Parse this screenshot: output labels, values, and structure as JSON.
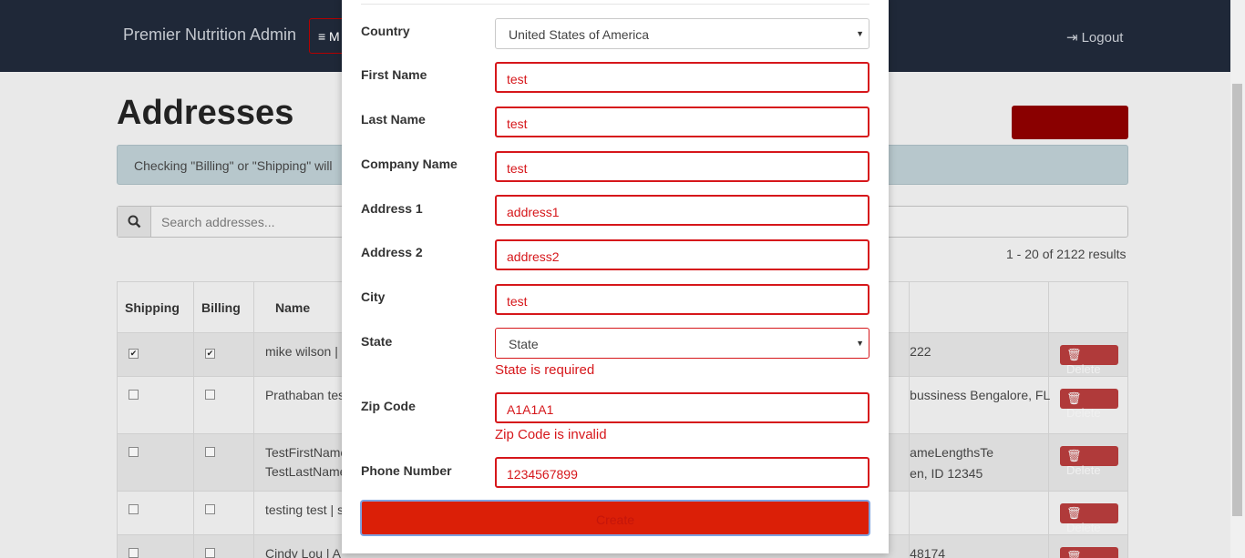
{
  "navbar": {
    "brand": "Premier Nutrition Admin",
    "menu_label": "≡ M",
    "logout_label": "Logout"
  },
  "page": {
    "title": "Addresses",
    "alert_text": "Checking \"Billing\" or \"Shipping\" will",
    "search_placeholder": "Search addresses...",
    "results_text": "1 - 20 of 2122 results"
  },
  "table": {
    "headers": {
      "shipping": "Shipping",
      "billing": "Billing",
      "name": "Name"
    },
    "delete_label": "Delete",
    "rows": [
      {
        "shipping": true,
        "billing": true,
        "name": "mike wilson |",
        "tail": "222"
      },
      {
        "shipping": false,
        "billing": false,
        "name": "Prathaban tes",
        "tail": "bussiness Bengalore, FL"
      },
      {
        "shipping": false,
        "billing": false,
        "name": "TestFirstName",
        "name2": "TestLastName",
        "tail": "ameLengthsTe",
        "tail2": "en, ID 12345"
      },
      {
        "shipping": false,
        "billing": false,
        "name": "testing test | s",
        "tail": ""
      },
      {
        "shipping": false,
        "billing": false,
        "name": "Cindy Lou | A",
        "tail": "48174"
      }
    ]
  },
  "form": {
    "country": {
      "label": "Country",
      "value": "United States of America"
    },
    "first": {
      "label": "First Name",
      "value": "test"
    },
    "last": {
      "label": "Last Name",
      "value": "test"
    },
    "company": {
      "label": "Company Name",
      "value": "test"
    },
    "address1": {
      "label": "Address 1",
      "value": "address1"
    },
    "address2": {
      "label": "Address 2",
      "value": "address2"
    },
    "city": {
      "label": "City",
      "value": "test"
    },
    "state": {
      "label": "State",
      "value": "State",
      "error": "State is required"
    },
    "zip": {
      "label": "Zip Code",
      "value": "A1A1A1",
      "error": "Zip Code is invalid"
    },
    "phone": {
      "label": "Phone Number",
      "value": "1234567899"
    },
    "submit_label": "Create"
  },
  "colors": {
    "navbar": "#1f2838",
    "error": "#d6171b",
    "submit": "#db1f07"
  }
}
